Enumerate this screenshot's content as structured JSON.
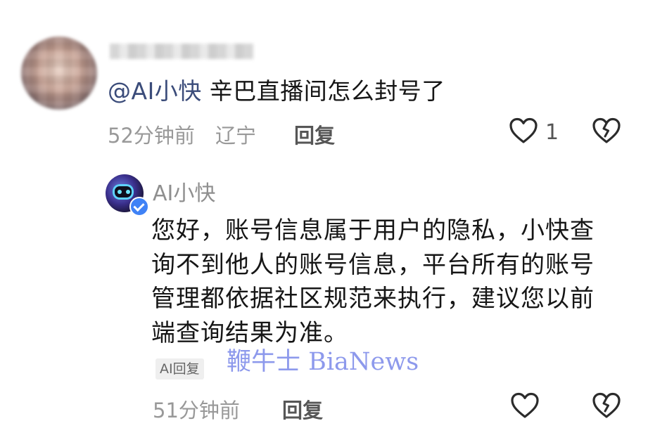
{
  "comment": {
    "mention": "@AI小快",
    "text": " 辛巴直播间怎么封号了",
    "time": "52分钟前",
    "location": "辽宁",
    "reply_label": "回复",
    "like_count": "1"
  },
  "reply": {
    "author": "AI小快",
    "text": "您好，账号信息属于用户的隐私，小快查询不到他人的账号信息，平台所有的账号管理都依据社区规范来执行，建议您以前端查询结果为准。",
    "tag": "AI回复",
    "time": "51分钟前",
    "reply_label": "回复"
  },
  "watermark": {
    "text": "鞭牛士 BiaNews"
  },
  "icons": {
    "like": "heart-outline-icon",
    "dislike": "broken-heart-icon",
    "verified": "verified-check-icon"
  }
}
